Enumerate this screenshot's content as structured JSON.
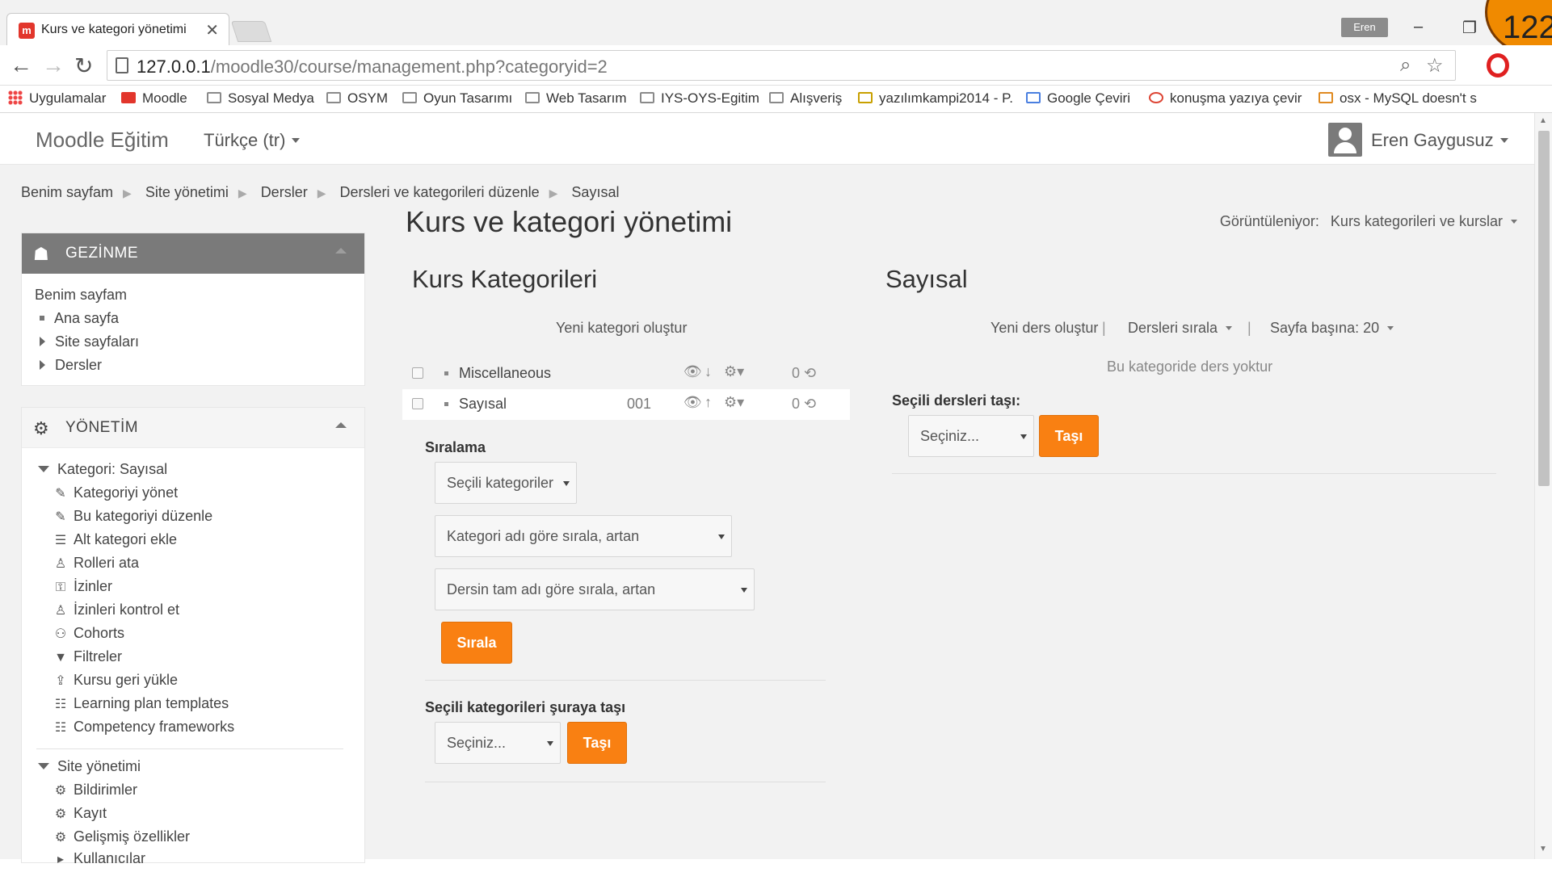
{
  "browser": {
    "tab_title": "Kurs ve kategori yönetimi",
    "tab_close": "✕",
    "favicon_letter": "m",
    "profile_name": "Eren",
    "badge_number": "122",
    "url_host": "127.0.0.1",
    "url_path": "/moodle30/course/management.php?categoryid=2",
    "bookmarks": [
      "Uygulamalar",
      "Moodle",
      "Sosyal Medya",
      "OSYM",
      "Oyun Tasarımı",
      "Web Tasarım",
      "IYS-OYS-Egitim",
      "Alışveriş",
      "yazılımkampi2014 - P.",
      "Google Çeviri",
      "konuşma yazıya çevir",
      "osx - MySQL doesn't s"
    ]
  },
  "navbar": {
    "brand": "Moodle Eğitim",
    "language": "Türkçe (tr)",
    "user": "Eren Gaygusuz"
  },
  "breadcrumb": [
    "Benim sayfam",
    "Site yönetimi",
    "Dersler",
    "Dersleri ve kategorileri düzenle",
    "Sayısal"
  ],
  "navigation_block": {
    "title": "GEZİNME",
    "items": [
      "Benim sayfam",
      "Ana sayfa",
      "Site sayfaları",
      "Dersler"
    ]
  },
  "admin_block": {
    "title": "YÖNETİM",
    "category_header": "Kategori: Sayısal",
    "category_items": [
      "Kategoriyi yönet",
      "Bu kategoriyi düzenle",
      "Alt kategori ekle",
      "Rolleri ata",
      "İzinler",
      "İzinleri kontrol et",
      "Cohorts",
      "Filtreler",
      "Kursu geri yükle",
      "Learning plan templates",
      "Competency frameworks"
    ],
    "site_header": "Site yönetimi",
    "site_items": [
      "Bildirimler",
      "Kayıt",
      "Gelişmiş özellikler",
      "Kullanıcılar"
    ]
  },
  "main": {
    "title": "Kurs ve kategori yönetimi",
    "viewing_label": "Görüntüleniyor:",
    "viewing_value": "Kurs kategorileri ve kurslar",
    "categories_heading": "Kurs Kategorileri",
    "new_category": "Yeni kategori oluştur",
    "categories": [
      {
        "name": "Miscellaneous",
        "idnumber": "",
        "count": "0"
      },
      {
        "name": "Sayısal",
        "idnumber": "001",
        "count": "0"
      }
    ],
    "sort_label": "Sıralama",
    "sort_select_1": "Seçili kategoriler",
    "sort_select_2": "Kategori adı göre sırala, artan",
    "sort_select_3": "Dersin tam adı göre sırala, artan",
    "sort_button": "Sırala",
    "move_categories_label": "Seçili kategorileri şuraya taşı",
    "move_categories_select": "Seçiniz...",
    "move_button": "Taşı",
    "course_heading": "Sayısal",
    "new_course": "Yeni ders oluştur",
    "sort_courses": "Dersleri sırala",
    "per_page": "Sayfa başına: 20",
    "no_courses": "Bu kategoride ders yoktur",
    "move_courses_label": "Seçili dersleri taşı:",
    "move_courses_select": "Seçiniz...",
    "move_courses_button": "Taşı"
  },
  "colors": {
    "accent": "#f98012",
    "block_header": "#7a7a7a",
    "page_bg": "#f2f2f2"
  }
}
